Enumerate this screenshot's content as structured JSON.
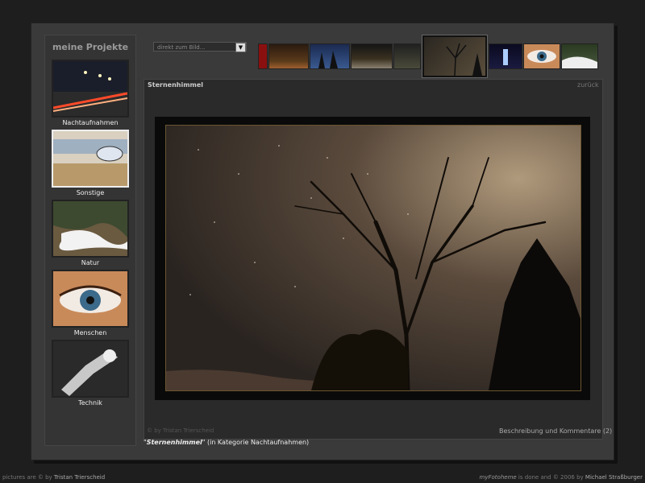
{
  "sidebar": {
    "title": "meine Projekte",
    "categories": [
      {
        "label": "Nachtaufnahmen"
      },
      {
        "label": "Sonstige"
      },
      {
        "label": "Natur"
      },
      {
        "label": "Menschen"
      },
      {
        "label": "Technik"
      }
    ]
  },
  "jump_select": {
    "value": "direkt zum Bild..."
  },
  "photo": {
    "title": "Sternenhimmel",
    "back_label": "zurück",
    "watermark": "© by Tristan Trierscheid",
    "comments_link": "Beschreibung und Kommentare (2)"
  },
  "caption": {
    "prefix": "\"",
    "title": "Sternenhimmel",
    "suffix": "\" (in Kategorie Nachtaufnahmen)"
  },
  "footer": {
    "left_text": "pictures are © by ",
    "left_name": "Tristan Trierscheid",
    "right_brand": "myFotoheme",
    "right_text": " is done and © 2006 by ",
    "right_name": "Michael Straßburger"
  }
}
